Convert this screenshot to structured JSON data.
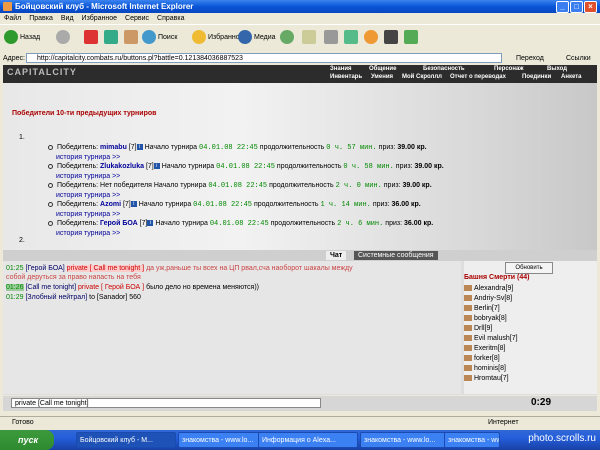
{
  "window": {
    "title": "Бойцовский клуб - Microsoft Internet Explorer"
  },
  "menu": [
    "Файл",
    "Правка",
    "Вид",
    "Избранное",
    "Сервис",
    "Справка"
  ],
  "toolbar": {
    "back": "Назад",
    "search": "Поиск",
    "favorites": "Избранное",
    "media": "Медиа"
  },
  "address": {
    "label": "Адрес:",
    "url": "http://capitalcity.combats.ru/buttons.pl?battle=0.121384036887523",
    "go": "Переход",
    "links": "Ссылки"
  },
  "site": {
    "logo": "CAPITALCITY",
    "nav_top": [
      "Знания",
      "Общение",
      "Безопасность",
      "Персонаж",
      "Выход"
    ],
    "nav_bottom": [
      "Инвентарь",
      "Умения",
      "Мой Скроллл",
      "Отчет о переводах",
      "Поединки",
      "Анкета"
    ]
  },
  "tournaments": {
    "heading": "Победители 10-ти предыдущих турниров",
    "list_num_1": "1.",
    "list_num_2": "2.",
    "winner_label": "Победитель:",
    "start_label": "Начало турнира",
    "duration_label": "продолжительность",
    "prize_label": "приз:",
    "history_link": "история турнира >>",
    "entries": [
      {
        "name": "mimabu",
        "level": "[7]",
        "date": "04.01.08 22:45",
        "duration": "0 ч. 57 мин.",
        "prize": "39.00 кр."
      },
      {
        "name": "Zlukakozluka",
        "level": "[7]",
        "date": "04.01.08 22:45",
        "duration": "0 ч. 58 мин.",
        "prize": "39.00 кр."
      },
      {
        "name": "Нет победителя",
        "level": "",
        "date": "04.01.08 22:45",
        "duration": "2 ч. 0 мин.",
        "prize": "39.00 кр."
      },
      {
        "name": "Azomi",
        "level": "[7]",
        "date": "04.01.08 22:45",
        "duration": "1 ч. 14 мин.",
        "prize": "36.00 кр."
      },
      {
        "name": "Герой БОА",
        "level": "[7]",
        "date": "04.01.08 22:45",
        "duration": "2 ч. 6 мин.",
        "prize": "36.00 кр."
      }
    ]
  },
  "chat": {
    "tabs": [
      "Чат",
      "Системные сообщения"
    ],
    "lines": [
      {
        "time": "01:25",
        "from": "[Герой БОА]",
        "private": "private [ Call me tonight ]",
        "text": "да уж,раньше ты всех на ЦП рвал,сча наоборот шакалы между",
        "text2": "собой деруться за право напасть на тебя"
      },
      {
        "time": "01:26",
        "from": "[Call me tonight]",
        "private": "private [ Герой БОА ]",
        "text": "было дело но времена меняются))"
      },
      {
        "time": "01:29",
        "from": "[Злобный нейтрал]",
        "private": "",
        "text": "to [Sanador] 560"
      }
    ]
  },
  "users": {
    "refresh": "Обновить",
    "header": "Башня Смерти (44)",
    "list": [
      "Alexandra[9]",
      "Andriy-Sv[8]",
      "Berlin[7]",
      "bobryak[8]",
      "Drll[9]",
      "Evil malush[7]",
      "Exeritm[8]",
      "forker[8]",
      "hominis[8]",
      "Hromtau[7]"
    ]
  },
  "input": {
    "value": "private [Call me tonight]",
    "clock": "0:29"
  },
  "status": {
    "ready": "Готово",
    "zone": "Интернет"
  },
  "taskbar": {
    "start": "пуск",
    "tasks": [
      "Бойцовский клуб - M...",
      "знакомства - www.lo...",
      "Информация о Alexa...",
      "знакомства - www.lo...",
      "знакомства - www.lo..."
    ],
    "watermark": "photo.scrolls.ru"
  }
}
